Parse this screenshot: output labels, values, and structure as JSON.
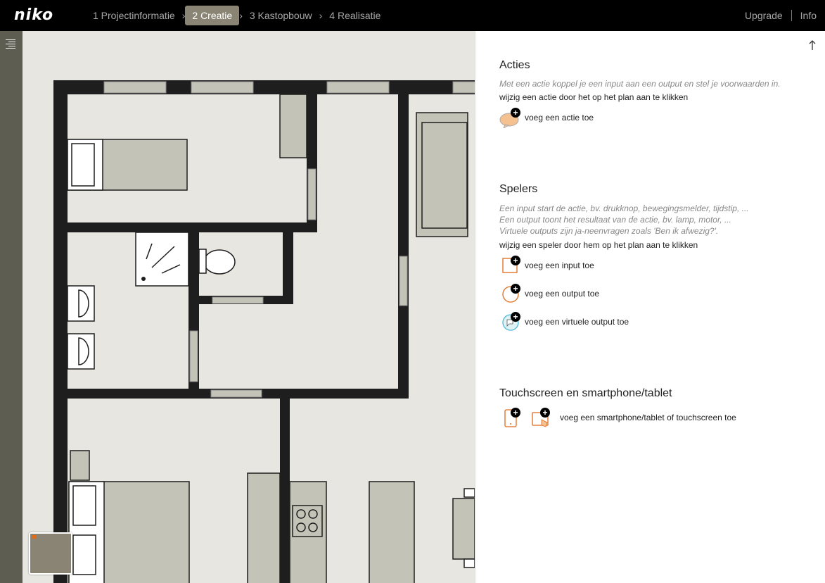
{
  "brand": "niko",
  "steps": [
    {
      "label": "1 Projectinformatie"
    },
    {
      "label": "2 Creatie"
    },
    {
      "label": "3 Kastopbouw"
    },
    {
      "label": "4 Realisatie"
    }
  ],
  "nav": {
    "upgrade": "Upgrade",
    "info": "Info"
  },
  "colors": {
    "accent": "#e06b1a",
    "step_active": "#8a8474",
    "wall": "#1e1e1e",
    "furniture": "#c4c3b8"
  },
  "acties": {
    "title": "Acties",
    "desc": "Met een actie koppel je een input aan een output en stel je voorwaarden in.",
    "hint": "wijzig een actie door het op het plan aan te klikken",
    "add_action": "voeg een actie toe"
  },
  "spelers": {
    "title": "Spelers",
    "desc1": "Een input start de actie, bv. drukknop, bewegingsmelder, tijdstip, ...",
    "desc2": "Een output toont het resultaat van de actie, bv. lamp, motor, ...",
    "desc3": "Virtuele outputs zijn ja-neenvragen zoals 'Ben ik afwezig?'.",
    "hint": "wijzig een speler door hem op het plan aan te klikken",
    "add_input": "voeg een input toe",
    "add_output": "voeg een output toe",
    "add_virtual": "voeg een virtuele output toe"
  },
  "touch": {
    "title": "Touchscreen en smartphone/tablet",
    "add_device": "voeg een smartphone/tablet of touchscreen toe"
  }
}
